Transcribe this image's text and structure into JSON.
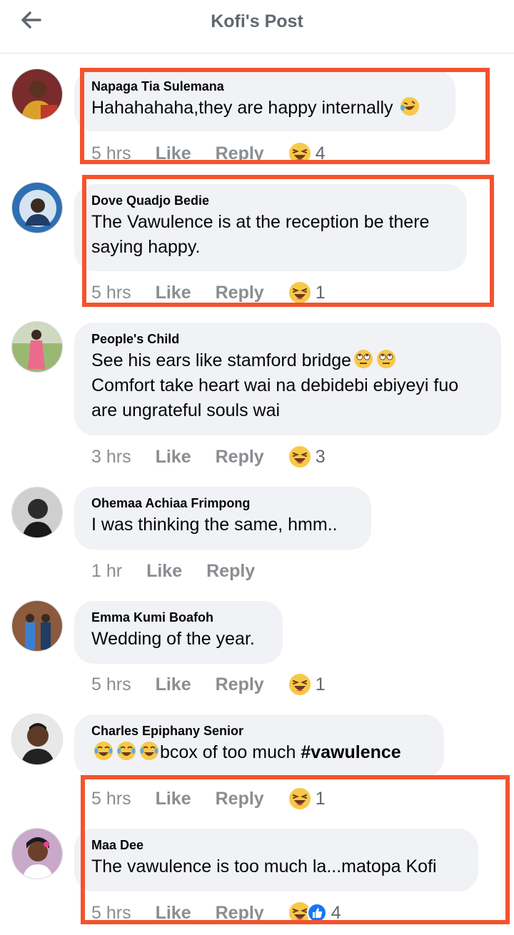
{
  "header": {
    "title": "Kofi's Post",
    "back_icon": "arrow-left-icon"
  },
  "colors": {
    "highlight": "#f4532e",
    "bubble": "#f0f2f5",
    "meta": "#8a8d91"
  },
  "comments": [
    {
      "author": "Napaga Tia Sulemana",
      "lines": [
        "Hahahahaha,they are happy internally"
      ],
      "time": "5 hrs",
      "like": "Like",
      "reply": "Reply",
      "reaction_count": "4",
      "reactions": [
        "laughing-emoji"
      ]
    },
    {
      "author": "Dove Quadjo Bedie",
      "lines": [
        "The Vawulence is at the reception be there",
        "saying happy."
      ],
      "time": "5 hrs",
      "like": "Like",
      "reply": "Reply",
      "reaction_count": "1",
      "reactions": [
        "laughing-emoji"
      ]
    },
    {
      "author": "People's Child",
      "lines": [
        "See his ears like stamford bridge",
        "Comfort take heart wai na debidebi ebiyeyi fuo",
        "are ungrateful souls wai"
      ],
      "time": "3 hrs",
      "like": "Like",
      "reply": "Reply",
      "reaction_count": "3",
      "reactions": [
        "laughing-emoji"
      ]
    },
    {
      "author": "Ohemaa Achiaa Frimpong",
      "lines": [
        "I was thinking the same, hmm.."
      ],
      "time": "1 hr",
      "like": "Like",
      "reply": "Reply",
      "reaction_count": "",
      "reactions": []
    },
    {
      "author": "Emma Kumi Boafoh",
      "lines": [
        "Wedding of the year."
      ],
      "time": "5 hrs",
      "like": "Like",
      "reply": "Reply",
      "reaction_count": "1",
      "reactions": [
        "laughing-emoji"
      ]
    },
    {
      "author": "Charles Epiphany Senior",
      "text_prefix": "bcox of too much ",
      "hashtag": "#vawulence",
      "time": "5 hrs",
      "like": "Like",
      "reply": "Reply",
      "reaction_count": "1",
      "reactions": [
        "laughing-emoji"
      ]
    },
    {
      "author": "Maa Dee",
      "lines": [
        "The vawulence is too much la...matopa Kofi"
      ],
      "time": "5 hrs",
      "like": "Like",
      "reply": "Reply",
      "reaction_count": "4",
      "reactions": [
        "laughing-emoji",
        "thumbs-up-emoji"
      ]
    }
  ]
}
